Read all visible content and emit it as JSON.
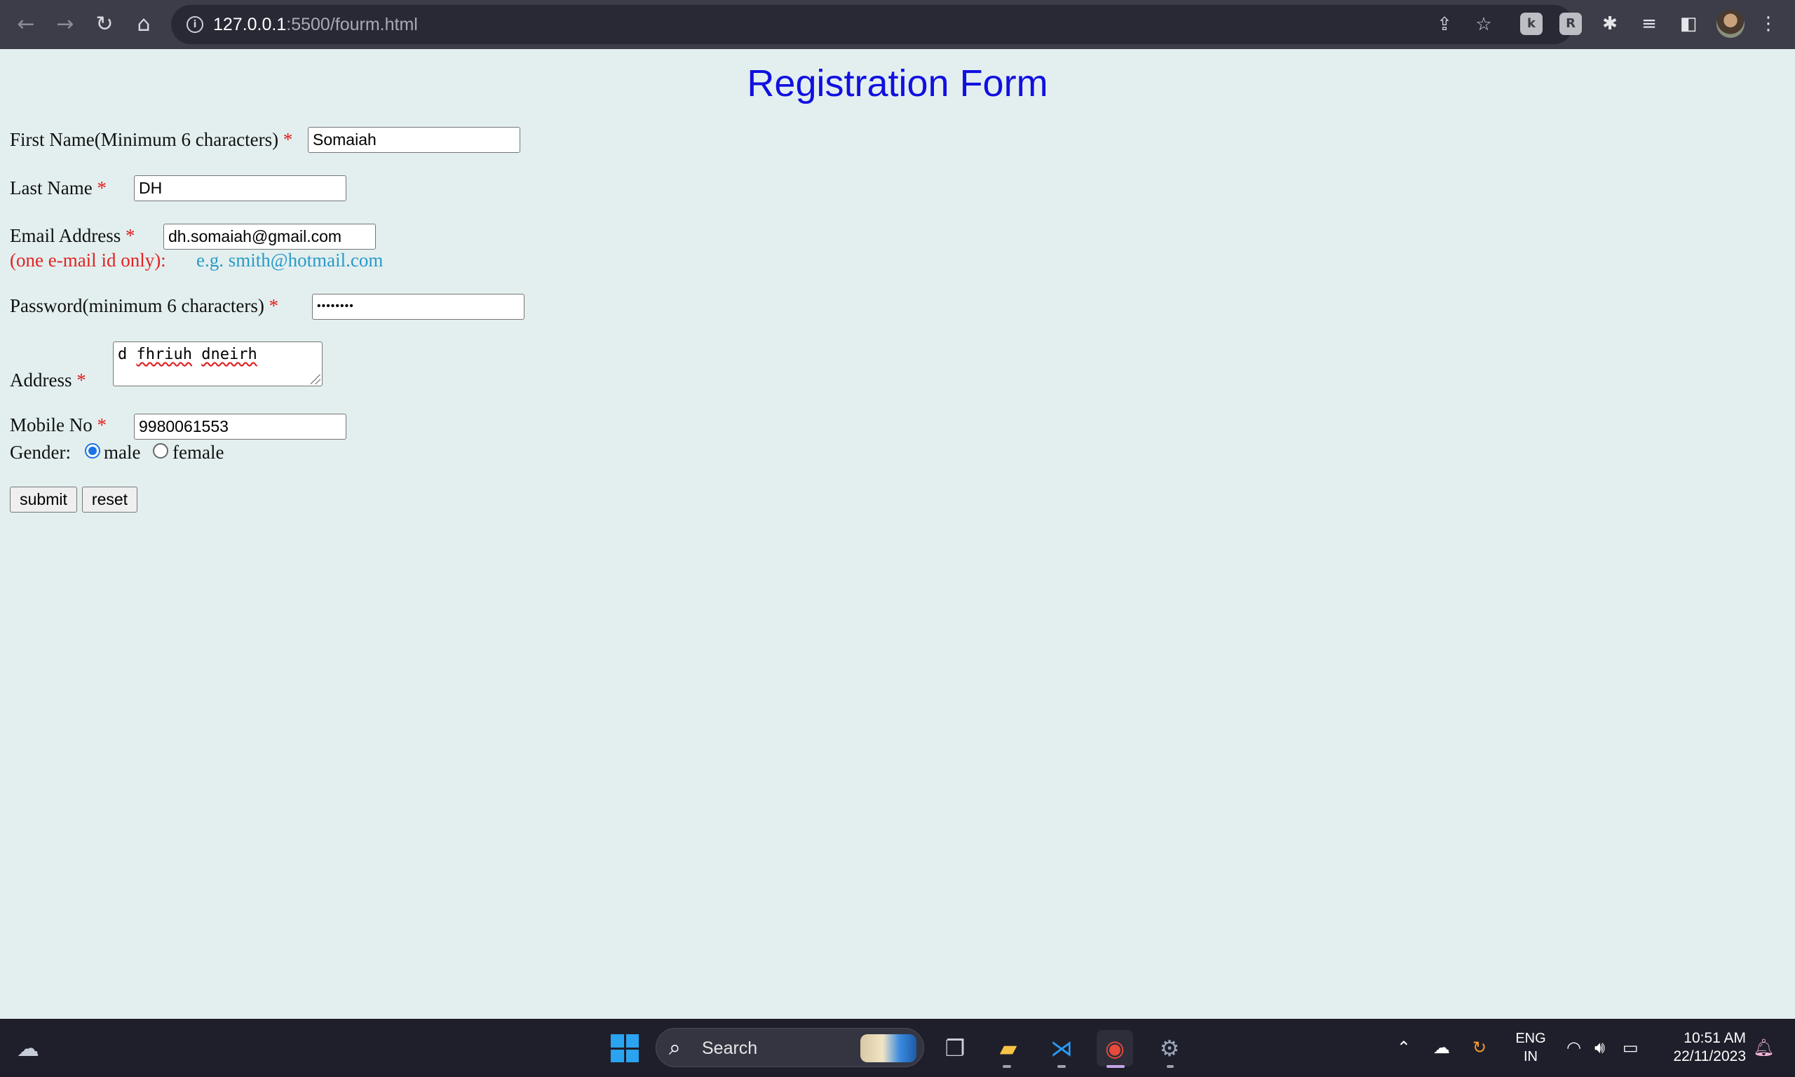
{
  "browser": {
    "url_host": "127.0.0.1",
    "url_rest": ":5500/fourm.html",
    "icons": [
      "back-arrow-icon",
      "forward-arrow-icon",
      "reload-icon",
      "home-icon",
      "site-info-icon",
      "share-icon",
      "bookmark-star-icon",
      "extension-icon",
      "puzzle-icon",
      "media-control-icon",
      "side-panel-icon",
      "profile-avatar",
      "menu-dots-icon"
    ]
  },
  "form": {
    "title": "Registration Form",
    "required_mark": "*",
    "first_name_label": "First Name(Minimum 6 characters)",
    "first_name_value": "Somaiah",
    "last_name_label": "Last Name",
    "last_name_value": "DH",
    "email_label": "Email Address",
    "email_value": "dh.somaiah@gmail.com",
    "email_note": "(one e-mail id only):",
    "email_hint": "e.g. smith@hotmail.com",
    "password_label": "Password(minimum 6 characters)",
    "password_mask": "••••••••",
    "address_label": "Address",
    "address_value_word1": "d",
    "address_value_word2": "fhriuh",
    "address_value_word3": "dneirh",
    "mobile_label": "Mobile No",
    "mobile_value": "9980061553",
    "gender_label": "Gender:",
    "gender_male": "male",
    "gender_female": "female",
    "gender_selected": "male",
    "submit_label": "submit",
    "reset_label": "reset"
  },
  "taskbar": {
    "search_placeholder": "Search",
    "lang_line1": "ENG",
    "lang_line2": "IN",
    "time": "10:51 AM",
    "date": "22/11/2023",
    "accent": "#1a73e8"
  }
}
